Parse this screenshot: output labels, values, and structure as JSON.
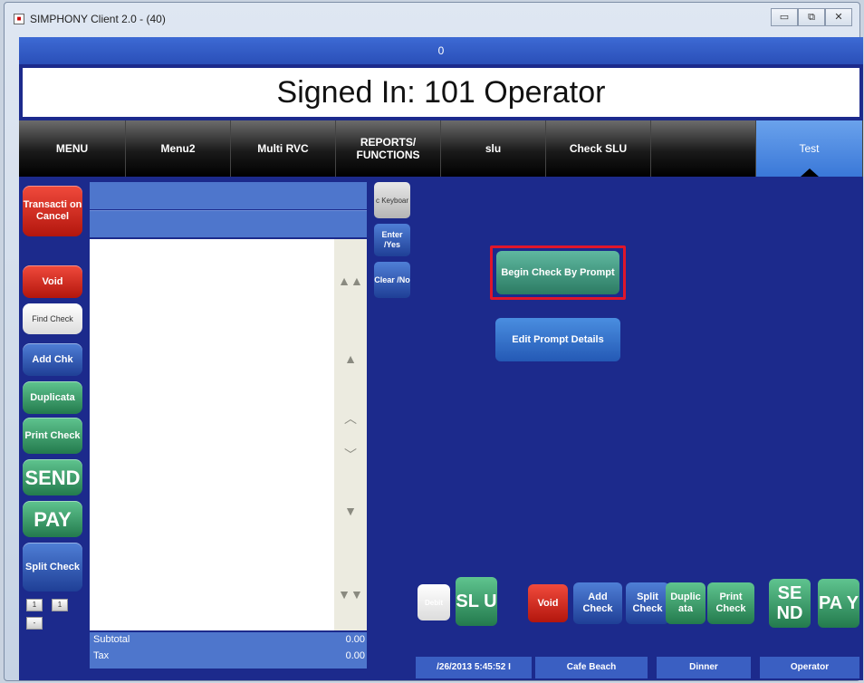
{
  "window": {
    "title": "SIMPHONY Client 2.0 - (40)",
    "minimize": "▭",
    "maximize": "⧉",
    "close": "✕"
  },
  "status": {
    "center": "0"
  },
  "signin": "Signed In: 101 Operator",
  "tabs": [
    "MENU",
    "Menu2",
    "Multi RVC",
    "REPORTS/ FUNCTIONS",
    "slu",
    "Check SLU",
    "",
    "Test"
  ],
  "left": {
    "transaction_cancel": "Transacti on Cancel",
    "void": "Void",
    "find_check": "Find Check",
    "add_chk": "Add Chk",
    "duplicate": "Duplicata",
    "print_check": "Print Check",
    "send": "SEND",
    "pay": "PAY",
    "split_check": "Split Check",
    "key1": "1",
    "key2": "1",
    "key3": "-"
  },
  "keys": {
    "keyboard": "c Keyboar",
    "enter": "Enter /Yes",
    "clear": "Clear /No"
  },
  "prompt": {
    "begin": "Begin Check By Prompt",
    "edit": "Edit Prompt Details"
  },
  "totals": {
    "subtotal_label": "Subtotal",
    "subtotal_value": "0.00",
    "tax_label": "Tax",
    "tax_value": "0.00"
  },
  "bottom": {
    "debit": "Debit",
    "slu": "SL U",
    "void": "Void",
    "add_check": "Add Check",
    "split_check": "Split Check",
    "duplicate": "Duplic ata",
    "print_check": "Print Check",
    "send": "SE ND",
    "pay": "PA Y"
  },
  "footer": {
    "datetime": "/26/2013 5:45:52 I",
    "location": "Cafe Beach",
    "period": "Dinner",
    "operator": "Operator"
  },
  "colors": {
    "background": "#1c2a8c",
    "accent": "#4e76cc",
    "highlight": "#e0162a"
  }
}
